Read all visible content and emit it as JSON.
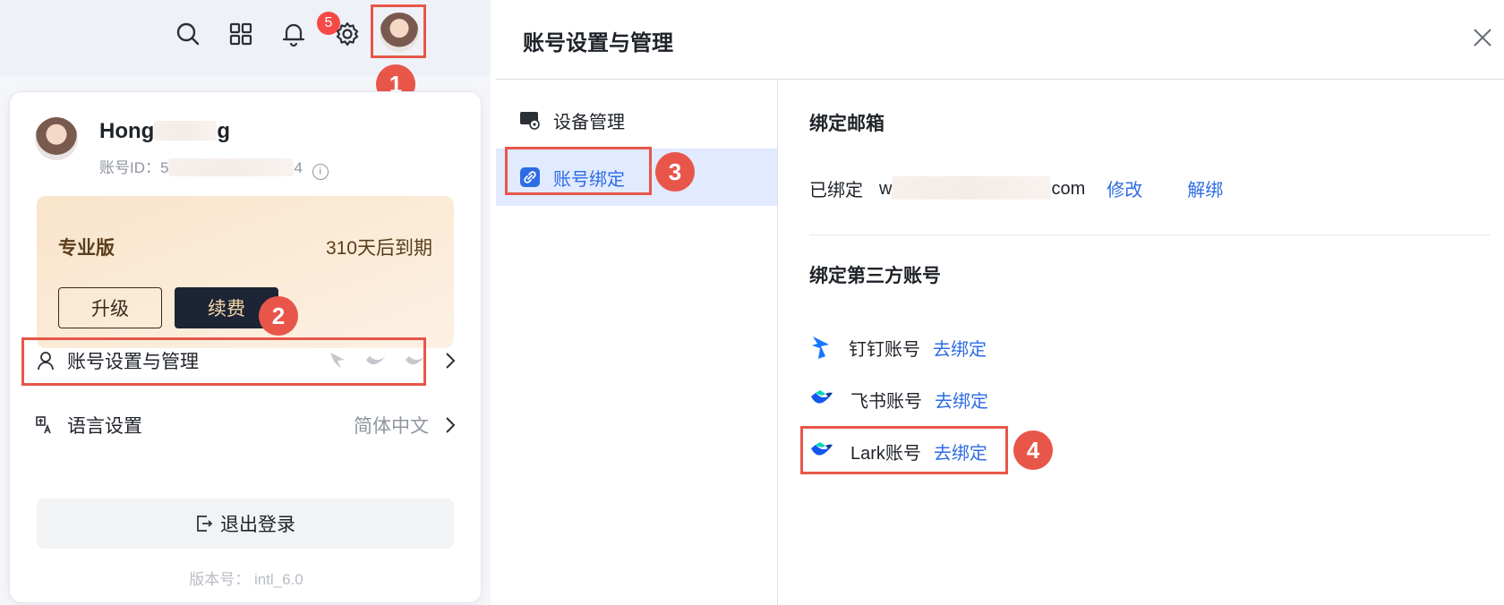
{
  "topbar": {
    "icons": [
      "search-icon",
      "apps-grid-icon",
      "bell-icon",
      "gear-icon"
    ],
    "notification_count": "5"
  },
  "profile": {
    "name": "Hong",
    "name_suffix": "g",
    "account_id_label": "账号ID：",
    "account_id_start": "5",
    "account_id_end": "4"
  },
  "plan": {
    "name": "专业版",
    "expiry": "310天后到期",
    "upgrade_label": "升级",
    "renew_label": "续费"
  },
  "menu": {
    "account_settings": "账号设置与管理",
    "language": "语言设置",
    "language_value": "简体中文",
    "logout": "退出登录",
    "version": "版本号： intl_6.0"
  },
  "dialog": {
    "title": "账号设置与管理",
    "nav": [
      {
        "label": "设备管理",
        "icon": "device-icon"
      },
      {
        "label": "账号绑定",
        "icon": "link-icon"
      }
    ],
    "email_section": {
      "title": "绑定邮箱",
      "bound_label": "已绑定",
      "email_start": "w",
      "email_end": "com",
      "edit": "修改",
      "unbind": "解绑"
    },
    "third_party": {
      "title": "绑定第三方账号",
      "items": [
        {
          "name": "钉钉账号",
          "action": "去绑定",
          "icon": "dingtalk-icon"
        },
        {
          "name": "飞书账号",
          "action": "去绑定",
          "icon": "feishu-icon"
        },
        {
          "name": "Lark账号",
          "action": "去绑定",
          "icon": "lark-icon"
        }
      ]
    }
  },
  "markers": [
    "1",
    "2",
    "3",
    "4"
  ],
  "colors": {
    "accent": "#2e6ce5",
    "marker": "#e8564a",
    "badge": "#f54a45",
    "plan_dark": "#1d2435"
  }
}
